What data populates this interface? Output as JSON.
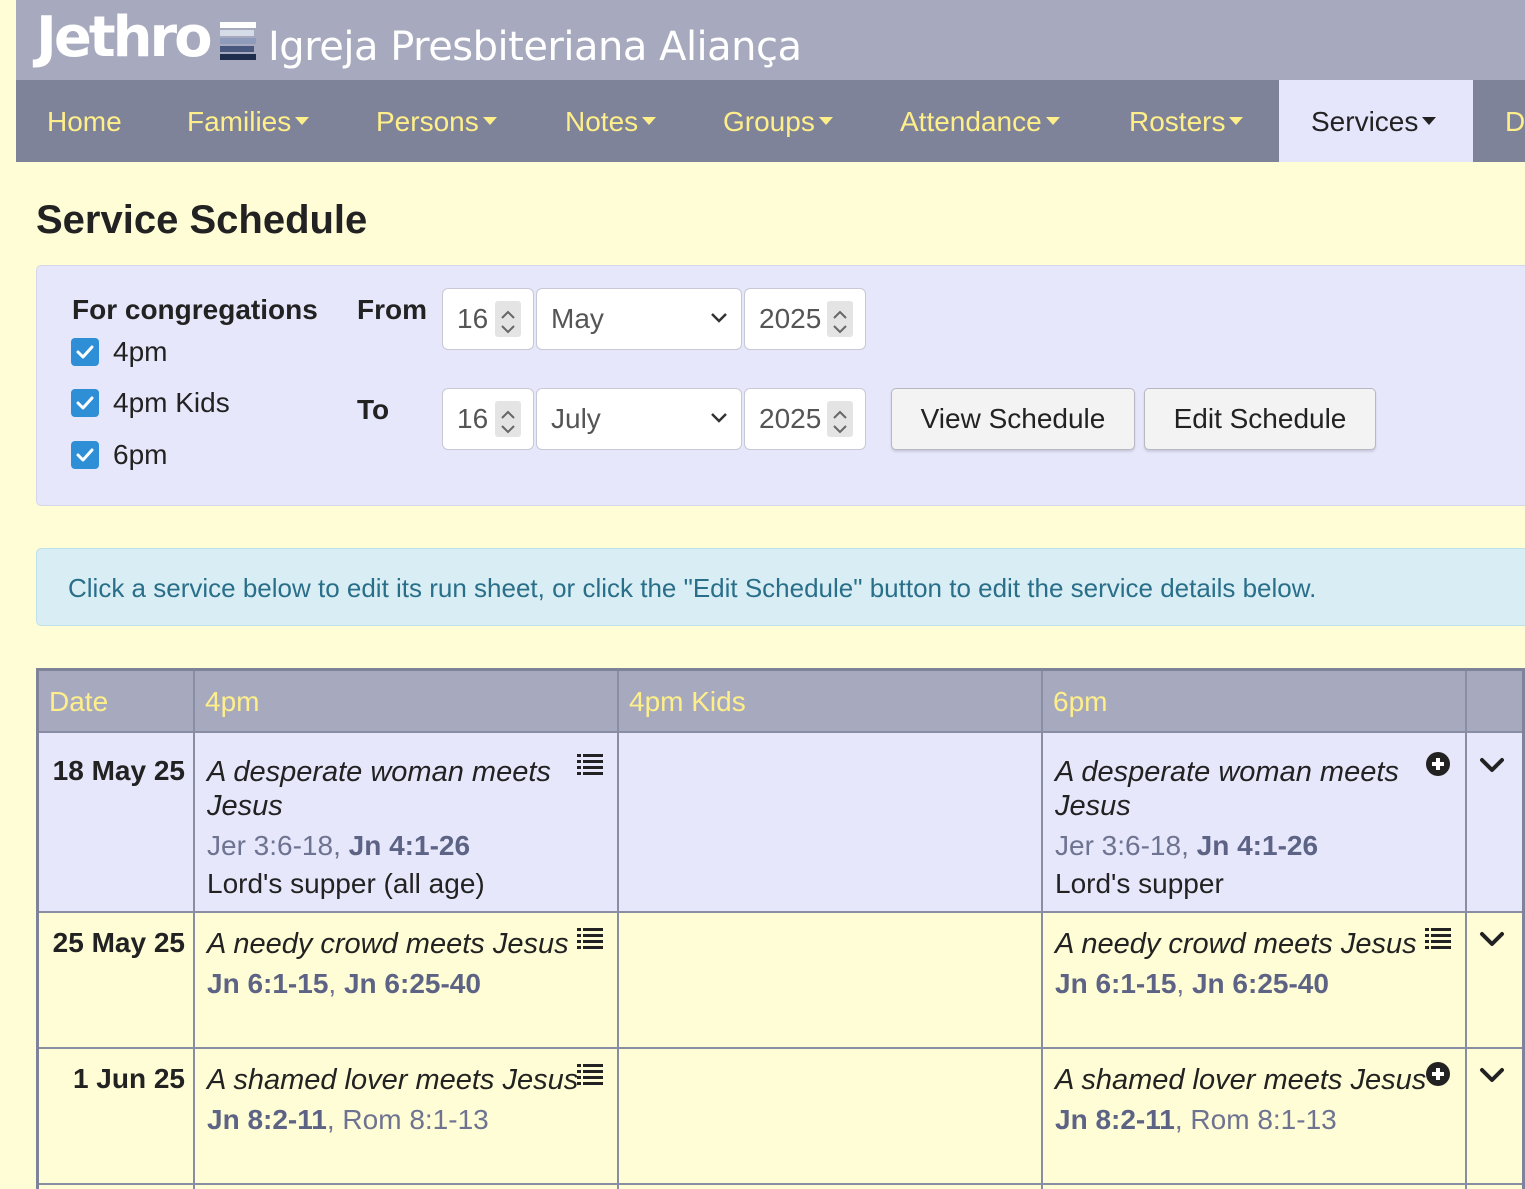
{
  "app": {
    "logo": "Jethro",
    "church_name": "Igreja Presbiteriana Aliança"
  },
  "nav": {
    "items": [
      {
        "label": "Home"
      },
      {
        "label": "Families"
      },
      {
        "label": "Persons"
      },
      {
        "label": "Notes"
      },
      {
        "label": "Groups"
      },
      {
        "label": "Attendance"
      },
      {
        "label": "Rosters"
      },
      {
        "label": "Services"
      },
      {
        "label": "D"
      }
    ],
    "active": "Services"
  },
  "page": {
    "title": "Service Schedule"
  },
  "filters": {
    "congregations_label": "For congregations",
    "congregations": [
      {
        "label": "4pm",
        "checked": true
      },
      {
        "label": "4pm Kids",
        "checked": true
      },
      {
        "label": "6pm",
        "checked": true
      }
    ],
    "from_label": "From",
    "to_label": "To",
    "from": {
      "day": "16",
      "month": "May",
      "year": "2025"
    },
    "to": {
      "day": "16",
      "month": "July",
      "year": "2025"
    },
    "view_button": "View Schedule",
    "edit_button": "Edit Schedule"
  },
  "info_message": "Click a service below to edit its run sheet, or click the \"Edit Schedule\" button to edit the service details below.",
  "table": {
    "headers": [
      "Date",
      "4pm",
      "4pm Kids",
      "6pm",
      ""
    ],
    "rows": [
      {
        "date": "18 May 25",
        "s4pm": {
          "title": "A desperate woman meets Jesus",
          "readings": [
            {
              "text": "Jer 3:6-18",
              "bold": false
            },
            {
              "text": "Jn 4:1-26",
              "bold": true
            }
          ],
          "sep": ", ",
          "note": "Lord's supper (all age)",
          "icon": "list-icon"
        },
        "s6pm": {
          "title": "A desperate woman meets Jesus",
          "readings": [
            {
              "text": "Jer 3:6-18",
              "bold": false
            },
            {
              "text": "Jn 4:1-26",
              "bold": true
            }
          ],
          "sep": ", ",
          "note": "Lord's supper",
          "icon": "plus-circle-icon"
        }
      },
      {
        "date": "25 May 25",
        "s4pm": {
          "title": "A needy crowd meets Jesus",
          "readings": [
            {
              "text": "Jn 6:1-15",
              "bold": true
            },
            {
              "text": "Jn 6:25-40",
              "bold": true
            }
          ],
          "sep": ", ",
          "icon": "list-icon"
        },
        "s6pm": {
          "title": "A needy crowd meets Jesus",
          "readings": [
            {
              "text": "Jn 6:1-15",
              "bold": true
            },
            {
              "text": "Jn 6:25-40",
              "bold": true
            }
          ],
          "sep": ", ",
          "icon": "list-icon"
        }
      },
      {
        "date": "1 Jun 25",
        "s4pm": {
          "title": "A shamed lover meets Jesus",
          "readings": [
            {
              "text": "Jn 8:2-11",
              "bold": true
            },
            {
              "text": "Rom 8:1-13",
              "bold": false
            }
          ],
          "sep": ", ",
          "icon": "list-icon"
        },
        "s6pm": {
          "title": "A shamed lover meets Jesus",
          "readings": [
            {
              "text": "Jn 8:2-11",
              "bold": true
            },
            {
              "text": "Rom 8:1-13",
              "bold": false
            }
          ],
          "sep": ", ",
          "icon": "plus-circle-icon"
        }
      }
    ]
  },
  "colors": {
    "page_bg": "#fffdd6",
    "brand_bar": "#a7aabe",
    "nav_bg": "#7e8399",
    "nav_text": "#ffef8a",
    "panel_bg": "#e6e7fb",
    "checkbox": "#2e8fd6",
    "info_text": "#2a6f8a"
  }
}
